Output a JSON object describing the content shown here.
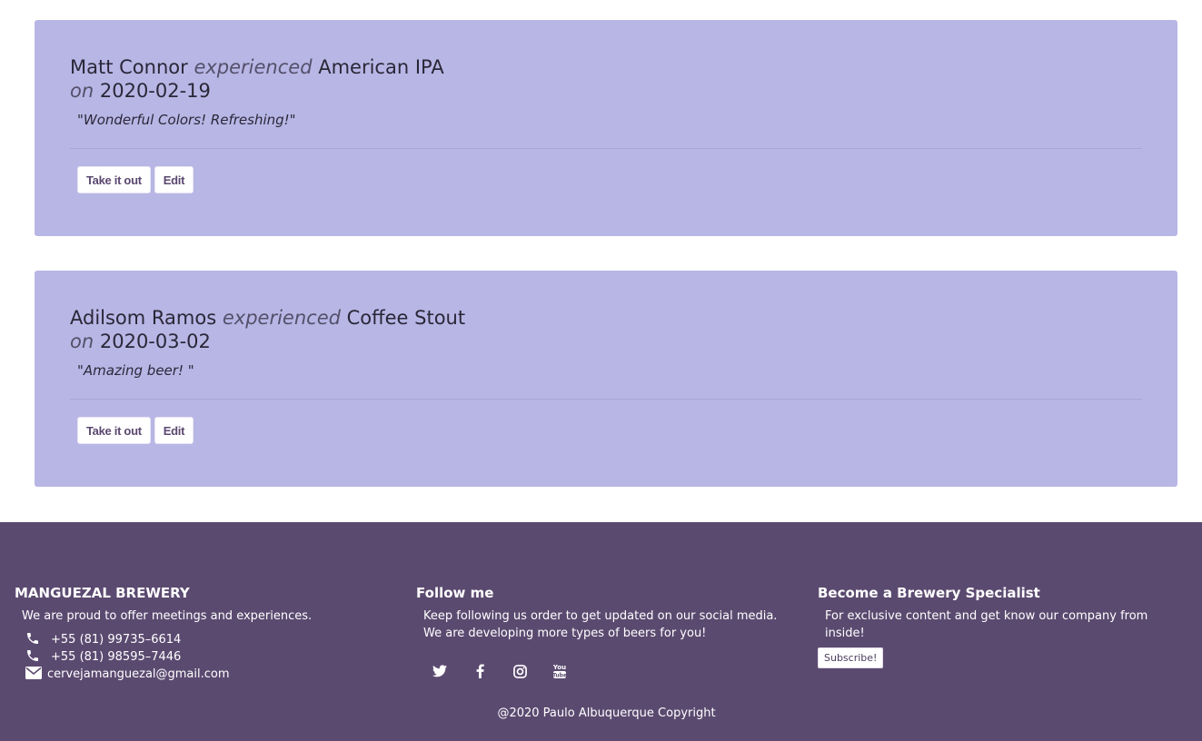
{
  "experiences": [
    {
      "user": "Matt Connor",
      "verb": "experienced",
      "beer": "American IPA",
      "on": "on",
      "date": "2020-02-19",
      "comment": "\"Wonderful Colors! Refreshing!\"",
      "take_out_label": "Take it out",
      "edit_label": "Edit"
    },
    {
      "user": "Adilsom Ramos",
      "verb": "experienced",
      "beer": "Coffee Stout",
      "on": "on",
      "date": "2020-03-02",
      "comment": "\"Amazing beer! \"",
      "take_out_label": "Take it out",
      "edit_label": "Edit"
    }
  ],
  "footer": {
    "about": {
      "title": "MANGUEZAL BREWERY",
      "text": "We are proud to offer meetings and experiences.",
      "phone1": "+55 (81) 99735–6614",
      "phone2": "+55 (81) 98595–7446",
      "email": "cervejamanguezal@gmail.com",
      "icons": [
        "phone-icon",
        "phone-icon",
        "envelope-icon"
      ]
    },
    "follow": {
      "title": "Follow me",
      "text": "Keep following us order to get updated on our social media. We are developing more types of beers for you!",
      "icons": [
        "twitter-icon",
        "facebook-icon",
        "instagram-icon",
        "youtube-icon"
      ]
    },
    "specialist": {
      "title": "Become a Brewery Specialist",
      "text": "For exclusive content and get know our company from inside!",
      "subscribe_label": "Subscribe!"
    },
    "copyright": "@2020 Paulo Albuquerque Copyright"
  },
  "colors": {
    "card_bg": "#b8b6e5",
    "footer_bg": "#5b4a70",
    "button_text": "#5b4870"
  }
}
